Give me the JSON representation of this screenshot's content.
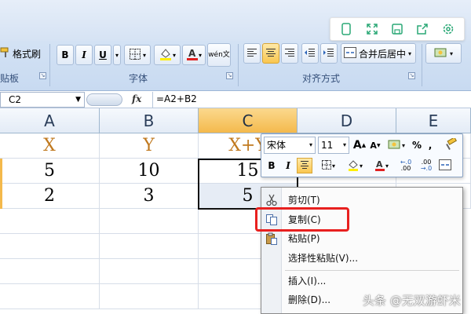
{
  "ribbon": {
    "format_painter_label": "格式刷",
    "clipboard_group_label": "贴板",
    "font_group_label": "字体",
    "align_group_label": "对齐方式",
    "merge_center_label": "合并后居中",
    "bold": "B",
    "italic": "I",
    "underline": "U",
    "phonetic_label": "wén文"
  },
  "formula_bar": {
    "cell_ref": "C2",
    "fx_label": "fx",
    "formula": "=A2+B2"
  },
  "sheet": {
    "columns": [
      "A",
      "B",
      "C",
      "D",
      "E"
    ],
    "selected_column": "C",
    "rows": [
      [
        "X",
        "Y",
        "X+Y"
      ],
      [
        "5",
        "10",
        "15"
      ],
      [
        "2",
        "3",
        "5"
      ]
    ]
  },
  "mini_toolbar": {
    "font_name": "宋体",
    "font_size": "11",
    "grow_font": "A",
    "shrink_font": "A",
    "percent": "%",
    "comma": ",",
    "bold": "B",
    "italic": "I",
    "inc_decimal": "+.0 .00",
    "dec_decimal": ".00 →.0"
  },
  "context_menu": {
    "items": [
      "剪切(T)",
      "复制(C)",
      "粘贴(P)",
      "选择性粘贴(V)...",
      "插入(I)...",
      "删除(D)..."
    ],
    "highlighted": "复制(C)",
    "highlight_color": "#e8201f"
  },
  "watermark": "头条 @无双游虾米"
}
